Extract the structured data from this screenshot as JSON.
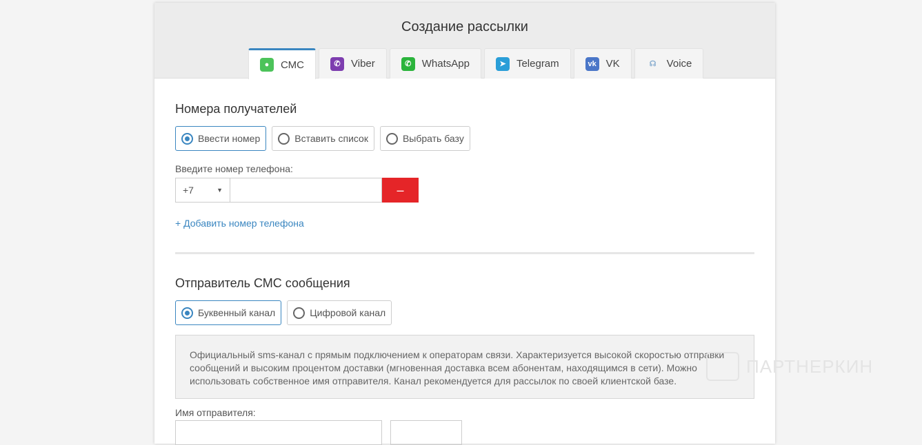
{
  "title": "Создание рассылки",
  "tabs": [
    {
      "label": "СМС",
      "color": "#4cc35a"
    },
    {
      "label": "Viber",
      "color": "#7d3daf"
    },
    {
      "label": "WhatsApp",
      "color": "#2bb43c"
    },
    {
      "label": "Telegram",
      "color": "#2a9ed8"
    },
    {
      "label": "VK",
      "color": "#4a76c8"
    },
    {
      "label": "Voice",
      "color": "#9ab8d8"
    }
  ],
  "recipients": {
    "heading": "Номера получателей",
    "options": [
      "Ввести номер",
      "Вставить список",
      "Выбрать базу"
    ],
    "phone_label": "Введите номер телефона:",
    "country_code": "+7",
    "phone_value": "",
    "remove_label": "–",
    "add_label": "+ Добавить номер телефона"
  },
  "sender": {
    "heading": "Отправитель СМС сообщения",
    "options": [
      "Буквенный канал",
      "Цифровой канал"
    ],
    "info": "Официальный sms-канал с прямым подключением к операторам связи. Характеризуется высокой скоростью отправки сообщений и высоким процентом доставки (мгновенная доставка всем абонентам, находящимся в сети). Можно использовать собственное имя отправителя. Канал рекомендуется для рассылок по своей клиентской базе.",
    "name_label": "Имя отправителя:"
  },
  "watermark": "ПАРТНЕРКИН"
}
